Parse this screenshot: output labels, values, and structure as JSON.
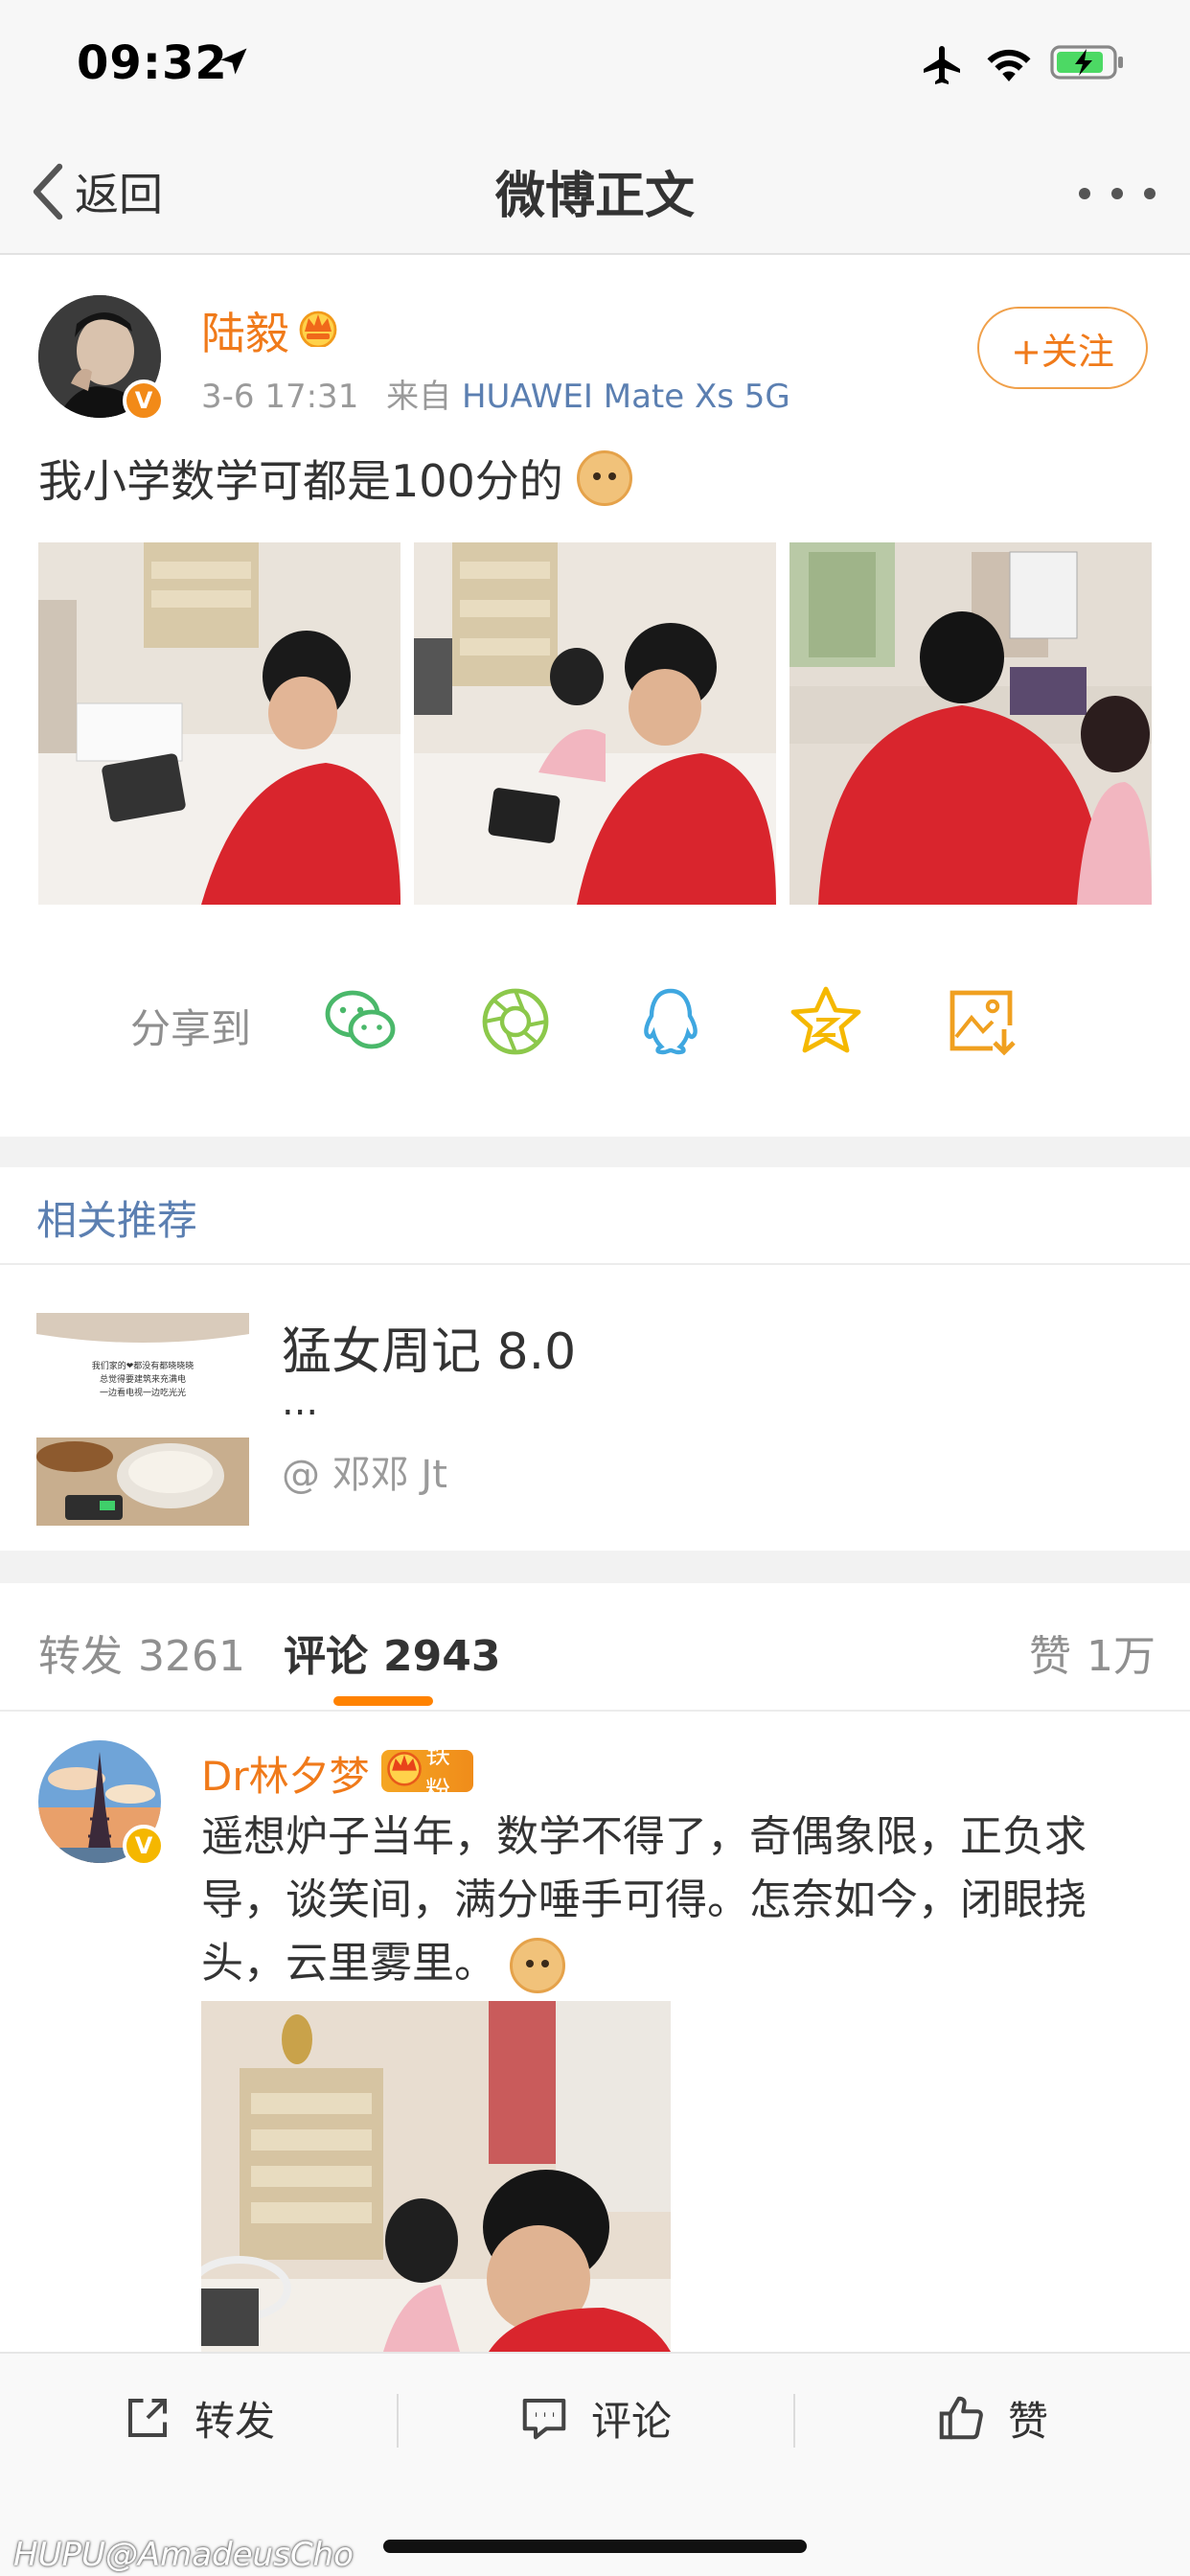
{
  "status_bar": {
    "time": "09:32",
    "icons": [
      "location-arrow-icon",
      "airplane-icon",
      "wifi-icon",
      "battery-charging-icon"
    ]
  },
  "nav": {
    "back_label": "返回",
    "title": "微博正文",
    "more_icon": "more-dots-icon"
  },
  "post": {
    "author": "陆毅",
    "author_badge": "crown-icon",
    "timestamp": "3-6 17:31",
    "source_prefix": "来自",
    "source": "HUAWEI Mate Xs 5G",
    "follow_label": "+关注",
    "text": "我小学数学可都是100分的",
    "emoji": "doge-emoji",
    "photos": [
      "photo-1",
      "photo-2",
      "photo-3"
    ],
    "share_label": "分享到",
    "share_icons": [
      "wechat-icon",
      "moments-icon",
      "qq-icon",
      "qzone-icon",
      "save-image-icon"
    ]
  },
  "related": {
    "title": "相关推荐",
    "card": {
      "title": "猛女周记 8.0",
      "ellipsis": "...",
      "author": "@ 邓邓 Jt",
      "thumb_text_line1": "我们家的❤都没有都晓晓晓",
      "thumb_text_line2": "总觉得要建筑来充满电",
      "thumb_text_line3": "一边看电视一边吃光光"
    }
  },
  "tabs": {
    "repost_label": "转发",
    "repost_count": "3261",
    "comment_label": "评论",
    "comment_count": "2943",
    "like_label": "赞",
    "like_count": "1万",
    "active": "comment"
  },
  "comment": {
    "author": "Dr林夕梦",
    "fan_badge": "铁粉",
    "text": "遥想炉子当年，数学不得了，奇偶象限，正负求导，谈笑间，满分唾手可得。怎奈如今，闭眼挠头，云里雾里。",
    "emoji": "doge-emoji"
  },
  "toolbar": {
    "repost": "转发",
    "comment": "评论",
    "like": "赞"
  },
  "watermark": "HUPU@AmadeusCho",
  "colors": {
    "accent_orange": "#f07a1a",
    "link_blue": "#5b7fb1",
    "tab_underline": "#ff8200"
  }
}
